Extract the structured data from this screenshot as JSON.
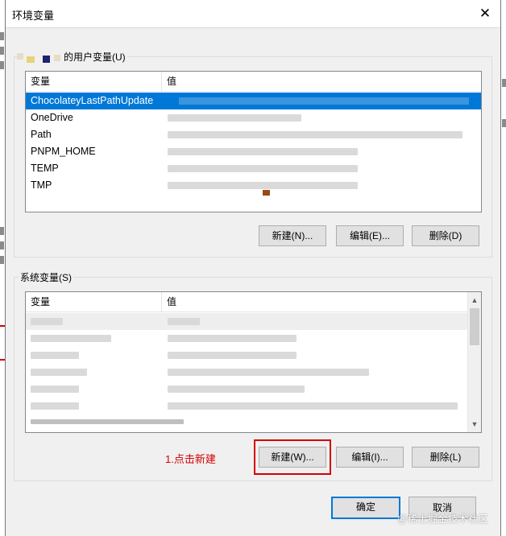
{
  "window": {
    "title": "环境变量",
    "close_icon": "close-icon"
  },
  "user_section": {
    "label": "的用户变量(U)",
    "columns": [
      "变量",
      "值"
    ],
    "rows": [
      "ChocolateyLastPathUpdate",
      "OneDrive",
      "Path",
      "PNPM_HOME",
      "TEMP",
      "TMP"
    ],
    "selected_index": 0,
    "buttons": {
      "new": "新建(N)...",
      "edit": "编辑(E)...",
      "delete": "删除(D)"
    }
  },
  "system_section": {
    "label": "系统变量(S)",
    "columns": [
      "变量",
      "值"
    ],
    "buttons": {
      "new": "新建(W)...",
      "edit": "编辑(I)...",
      "delete": "删除(L)"
    }
  },
  "annotation": {
    "text": "1.点击新建",
    "color": "#d40000"
  },
  "footer": {
    "ok": "确定",
    "cancel": "取消"
  },
  "watermark": "@稀土掘金技术社区",
  "colors": {
    "selection": "#0078d7",
    "accent": "#0078d7"
  }
}
